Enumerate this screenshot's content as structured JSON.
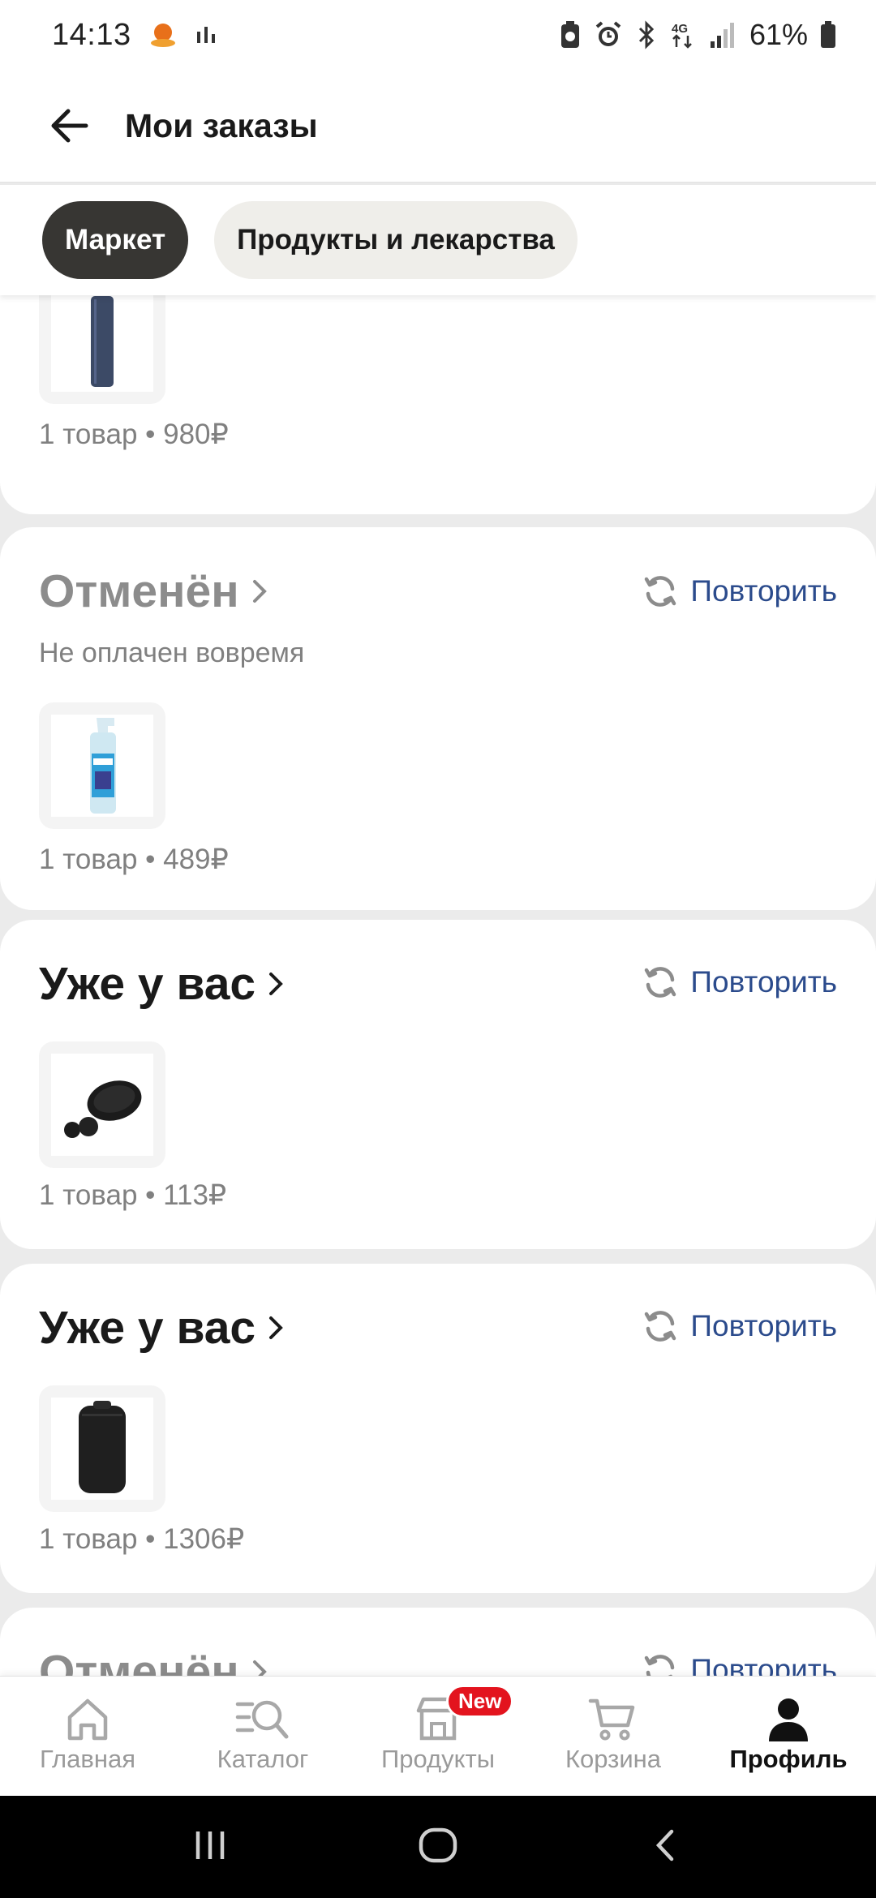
{
  "status_bar": {
    "time": "14:13",
    "network": "4G",
    "battery": "61%"
  },
  "header": {
    "title": "Мои заказы",
    "back_icon": "arrow-left-icon"
  },
  "tabs": [
    {
      "label": "Маркет",
      "active": true
    },
    {
      "label": "Продукты и лекарства",
      "active": false
    }
  ],
  "orders": [
    {
      "status": "",
      "note": "",
      "summary": "1 товар • 980₽",
      "product": "power-bank"
    },
    {
      "status": "Отменён",
      "note": "Не оплачен вовремя",
      "repeat_label": "Повторить",
      "summary": "1 товар • 489₽",
      "product": "cleaner-spray"
    },
    {
      "status": "Уже у вас",
      "note": "",
      "repeat_label": "Повторить",
      "summary": "1 товар • 113₽",
      "product": "earbuds"
    },
    {
      "status": "Уже у вас",
      "note": "",
      "repeat_label": "Повторить",
      "summary": "1 товар • 1306₽",
      "product": "backpack"
    },
    {
      "status": "Отменён",
      "repeat_label": "Повторить"
    }
  ],
  "bottom_nav": [
    {
      "label": "Главная",
      "icon": "home-icon",
      "active": false
    },
    {
      "label": "Каталог",
      "icon": "catalog-search-icon",
      "active": false
    },
    {
      "label": "Продукты",
      "icon": "store-icon",
      "active": false,
      "badge": "New"
    },
    {
      "label": "Корзина",
      "icon": "cart-icon",
      "active": false
    },
    {
      "label": "Профиль",
      "icon": "profile-icon",
      "active": true
    }
  ],
  "colors": {
    "accent_link": "#2b4b8c",
    "active_tab": "#373633",
    "badge": "#e3141e"
  }
}
